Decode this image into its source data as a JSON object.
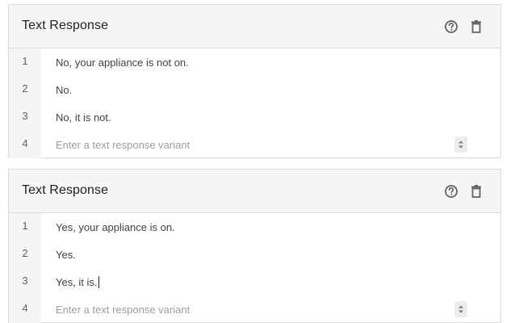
{
  "cards": [
    {
      "title": "Text Response",
      "icons": [
        "help-icon",
        "delete-icon"
      ],
      "rows": [
        {
          "number": "1",
          "text": "No, your appliance is not on."
        },
        {
          "number": "2",
          "text": "No."
        },
        {
          "number": "3",
          "text": "No, it is not."
        }
      ],
      "new_row": {
        "number": "4",
        "placeholder": "Enter a text response variant",
        "value": ""
      }
    },
    {
      "title": "Text Response",
      "icons": [
        "help-icon",
        "delete-icon"
      ],
      "rows": [
        {
          "number": "1",
          "text": "Yes, your appliance is on."
        },
        {
          "number": "2",
          "text": "Yes."
        },
        {
          "number": "3",
          "text": "Yes, it is."
        }
      ],
      "new_row": {
        "number": "4",
        "placeholder": "Enter a text response variant",
        "value": ""
      }
    }
  ],
  "colors": {
    "header_bg": "#f5f5f5",
    "border": "#dcdcdc",
    "text": "#424242",
    "placeholder": "#9e9e9e",
    "icon": "#616161"
  }
}
